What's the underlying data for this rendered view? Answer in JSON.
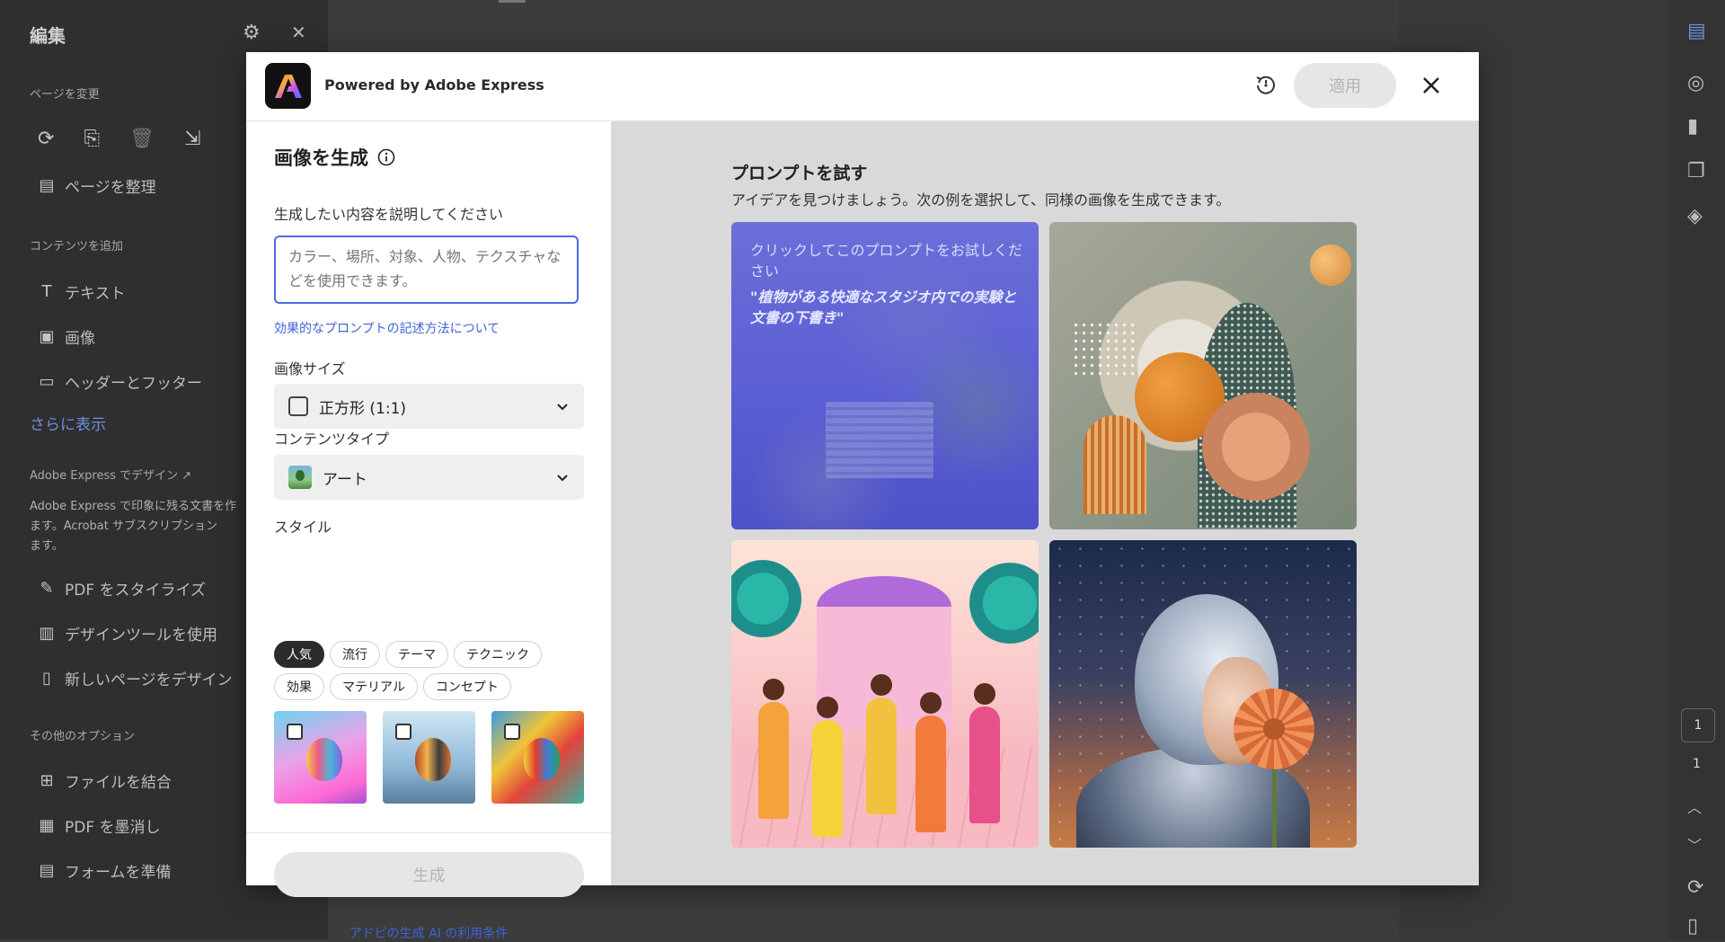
{
  "background_app": {
    "panel_title": "編集",
    "sections": {
      "change_page": "ページを変更",
      "add_content": "コンテンツを追加",
      "adobe_express_design": "Adobe Express でデザイン",
      "other_options": "その他のオプション"
    },
    "items": {
      "organize_pages": "ページを整理",
      "text": "テキスト",
      "image": "画像",
      "header_footer": "ヘッダーとフッター",
      "show_more": "さらに表示",
      "stylize_pdf": "PDF をスタイライズ",
      "use_design_tools": "デザインツールを使用",
      "design_new_page": "新しいページをデザイン",
      "combine_files": "ファイルを結合",
      "redact_pdf": "PDF を墨消し",
      "prepare_form": "フォームを準備"
    },
    "express_desc": "Adobe Express で印象に残る文書を作\nます。Acrobat サブスクリプション\nます。",
    "page_indicator": "1",
    "page_total": "1"
  },
  "modal": {
    "brand": "Powered by Adobe Express",
    "apply_label": "適用",
    "left": {
      "title": "画像を生成",
      "describe_label": "生成したい内容を説明してください",
      "prompt_placeholder": "カラー、場所、対象、人物、テクスチャなどを使用できます。",
      "help_link": "効果的なプロンプトの記述方法について",
      "size_label": "画像サイズ",
      "size_value": "正方形 (1:1)",
      "content_type_label": "コンテンツタイプ",
      "content_type_value": "アート",
      "style_label": "スタイル",
      "style_chips": [
        "人気",
        "流行",
        "テーマ",
        "テクニック",
        "効果",
        "マテリアル",
        "コンセプト"
      ],
      "active_chip": "人気",
      "generate_label": "生成",
      "terms_link": "アドビの生成 AI の利用条件"
    },
    "right": {
      "title": "プロンプトを試す",
      "subtitle": "アイデアを見つけましょう。次の例を選択して、同様の画像を生成できます。",
      "card1_hint": "クリックしてこのプロンプトをお試しください",
      "card1_prompt": "\"植物がある快適なスタジオ内での実験と文書の下書き\""
    }
  },
  "colors": {
    "accent_blue": "#4b6cde",
    "link_blue": "#3d63d8",
    "prompt_card": "#5b5fd4"
  }
}
